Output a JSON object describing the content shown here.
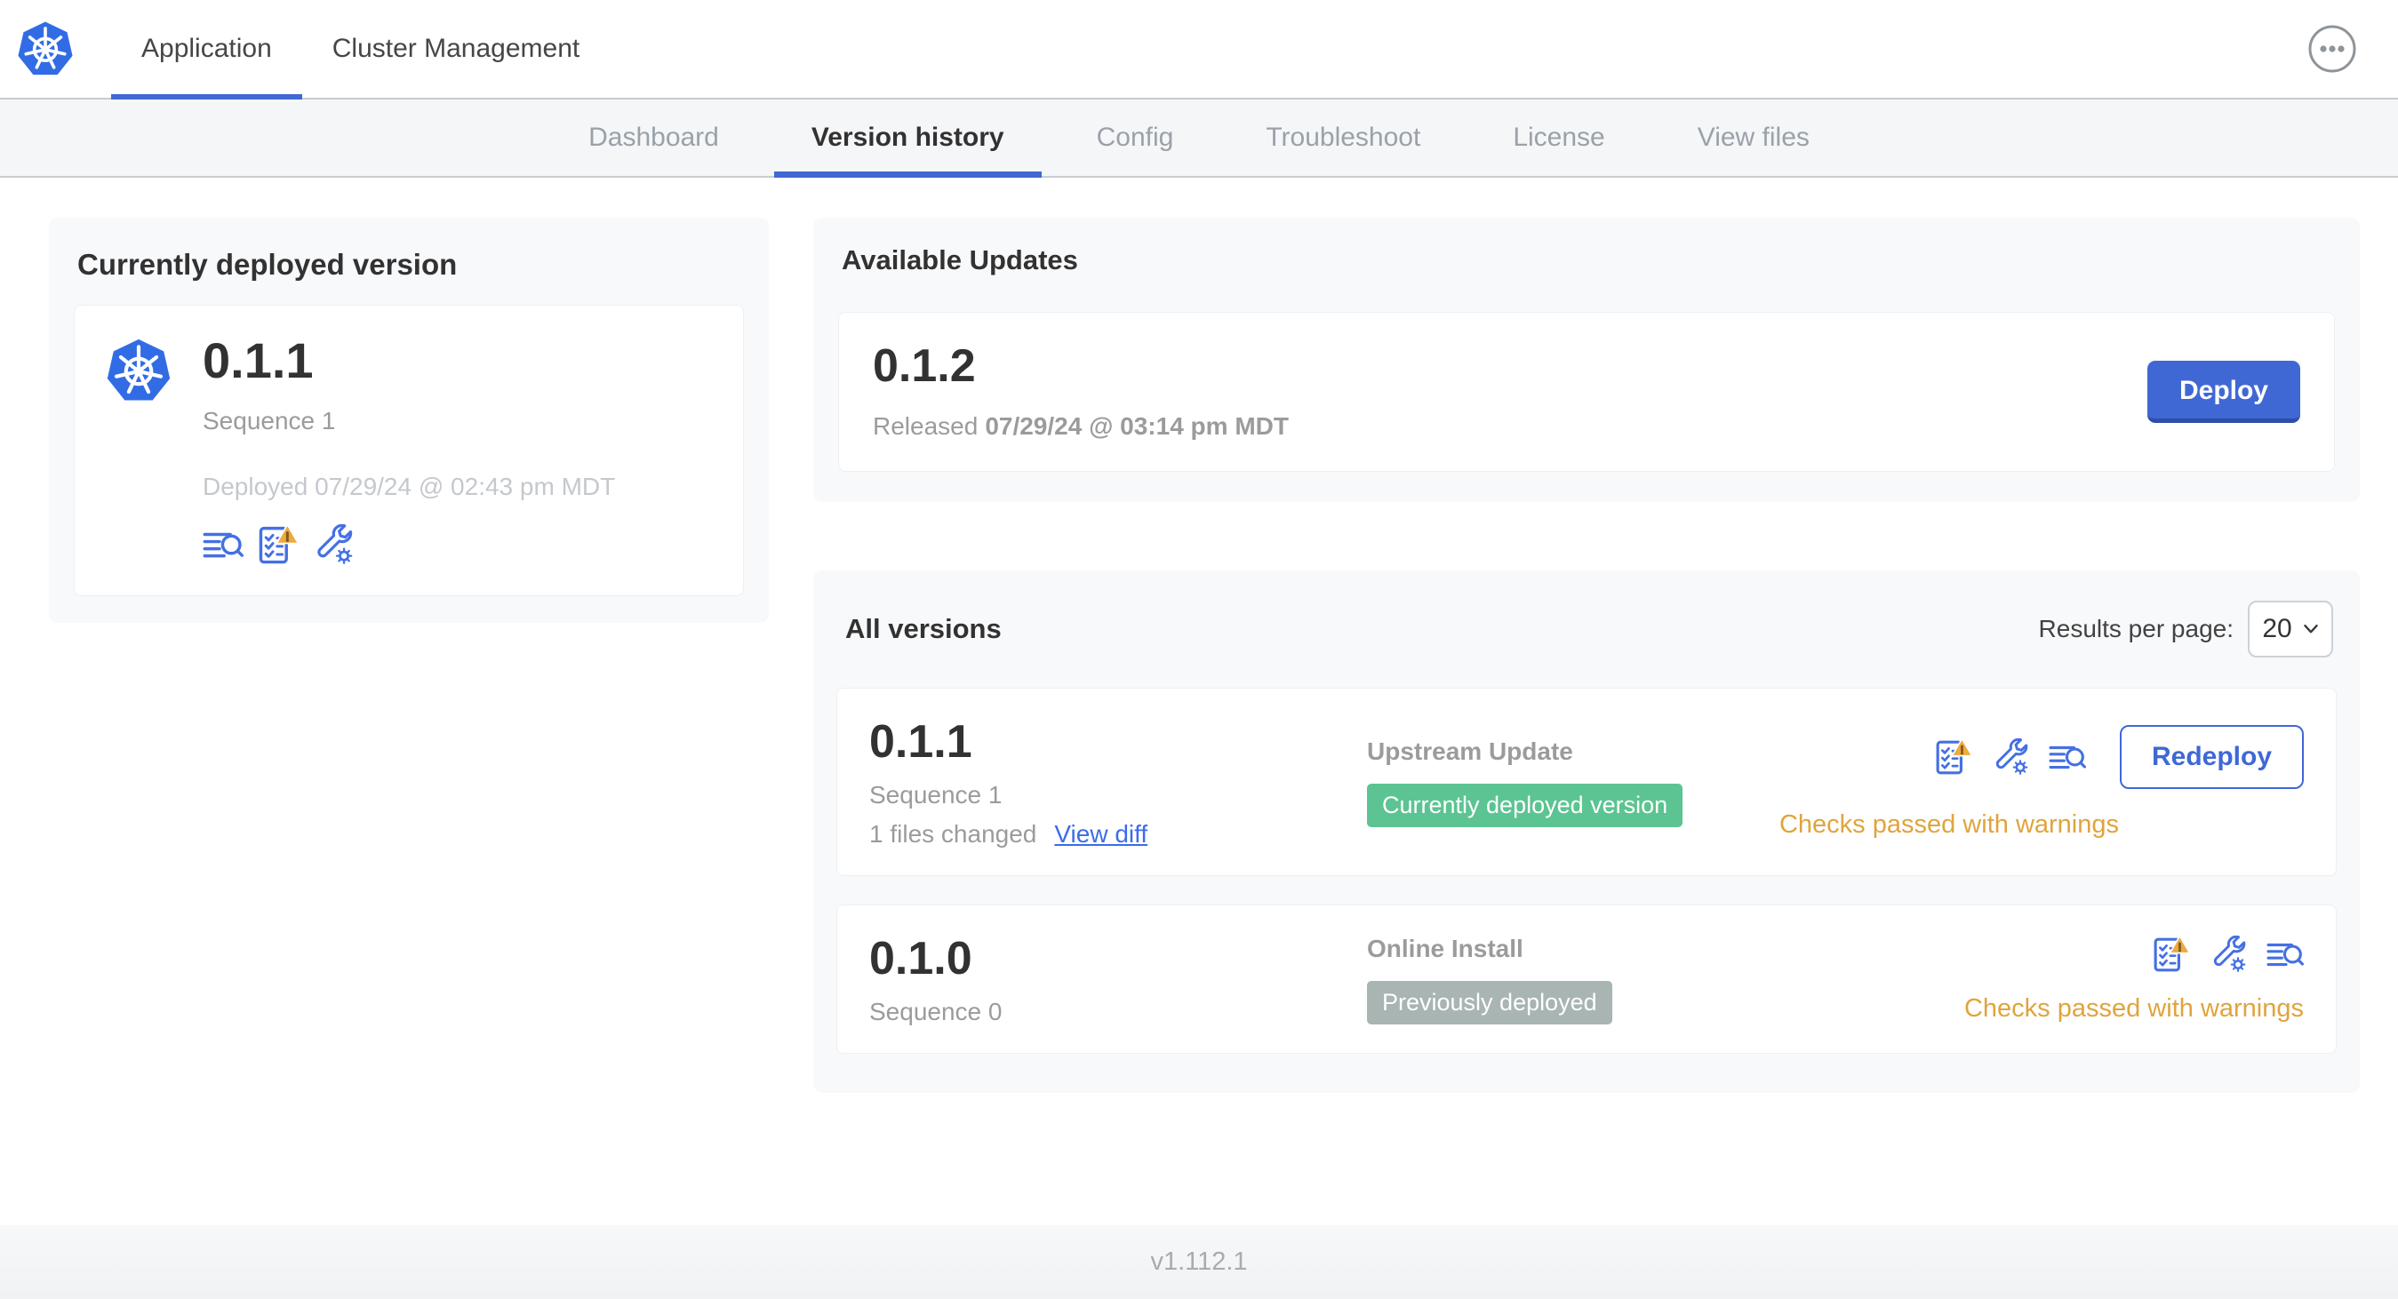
{
  "header": {
    "tabs": [
      {
        "label": "Application"
      },
      {
        "label": "Cluster Management"
      }
    ],
    "more_menu_icon": "ellipsis-icon"
  },
  "subnav": {
    "tabs": [
      {
        "label": "Dashboard"
      },
      {
        "label": "Version history"
      },
      {
        "label": "Config"
      },
      {
        "label": "Troubleshoot"
      },
      {
        "label": "License"
      },
      {
        "label": "View files"
      }
    ]
  },
  "currently_deployed": {
    "title": "Currently deployed version",
    "version": "0.1.1",
    "sequence": "Sequence 1",
    "deployed_at": "Deployed 07/29/24 @ 02:43 pm MDT",
    "icons": [
      "view-logs-icon",
      "preflight-checks-warning-icon",
      "edit-config-icon"
    ],
    "logo_icon": "kubernetes-logo"
  },
  "available_updates": {
    "title": "Available Updates",
    "version": "0.1.2",
    "released_prefix": "Released",
    "released_date": "07/29/24 @ 03:14 pm MDT",
    "deploy_label": "Deploy"
  },
  "all_versions": {
    "title": "All versions",
    "results_per_page_label": "Results per page:",
    "results_per_page_value": "20",
    "rows": [
      {
        "version": "0.1.1",
        "sequence": "Sequence 1",
        "files_changed": "1 files changed",
        "view_diff": "View diff",
        "source": "Upstream Update",
        "badge": "Currently deployed version",
        "badge_color": "#5cc492",
        "icons": [
          "preflight-checks-warning-icon",
          "edit-config-icon",
          "view-logs-icon"
        ],
        "status": "Checks passed with warnings",
        "action": "Redeploy"
      },
      {
        "version": "0.1.0",
        "sequence": "Sequence 0",
        "source": "Online Install",
        "badge": "Previously deployed",
        "badge_color": "#a8b5b2",
        "icons": [
          "preflight-checks-warning-icon",
          "edit-config-icon",
          "view-logs-icon"
        ],
        "status": "Checks passed with warnings"
      }
    ]
  },
  "footer": {
    "app_version": "v1.112.1"
  },
  "colors": {
    "accent_blue": "#4068d4",
    "icon_blue": "#4470e2",
    "badge_green": "#5cc492",
    "badge_gray": "#a8b5b2",
    "warning_amber": "#e0a43c"
  }
}
